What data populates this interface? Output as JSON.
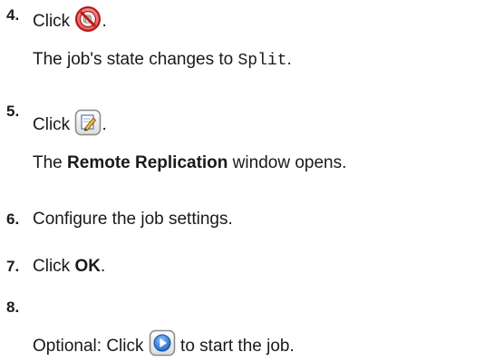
{
  "steps": [
    {
      "number": "4.",
      "click_label": "Click",
      "after_icon": ".",
      "icon": "split-icon",
      "result_prefix": "The job's state changes to ",
      "result_code": "Split",
      "result_suffix": "."
    },
    {
      "number": "5.",
      "click_label": "Click",
      "after_icon": ".",
      "icon": "edit-icon",
      "result_prefix": "The ",
      "result_bold": "Remote Replication",
      "result_suffix": " window opens."
    },
    {
      "number": "6.",
      "text": "Configure the job settings."
    },
    {
      "number": "7.",
      "prefix": "Click ",
      "bold": "OK",
      "suffix": "."
    },
    {
      "number": "8.",
      "prefix": "Optional: Click ",
      "icon": "play-icon",
      "suffix": " to start the job."
    }
  ]
}
